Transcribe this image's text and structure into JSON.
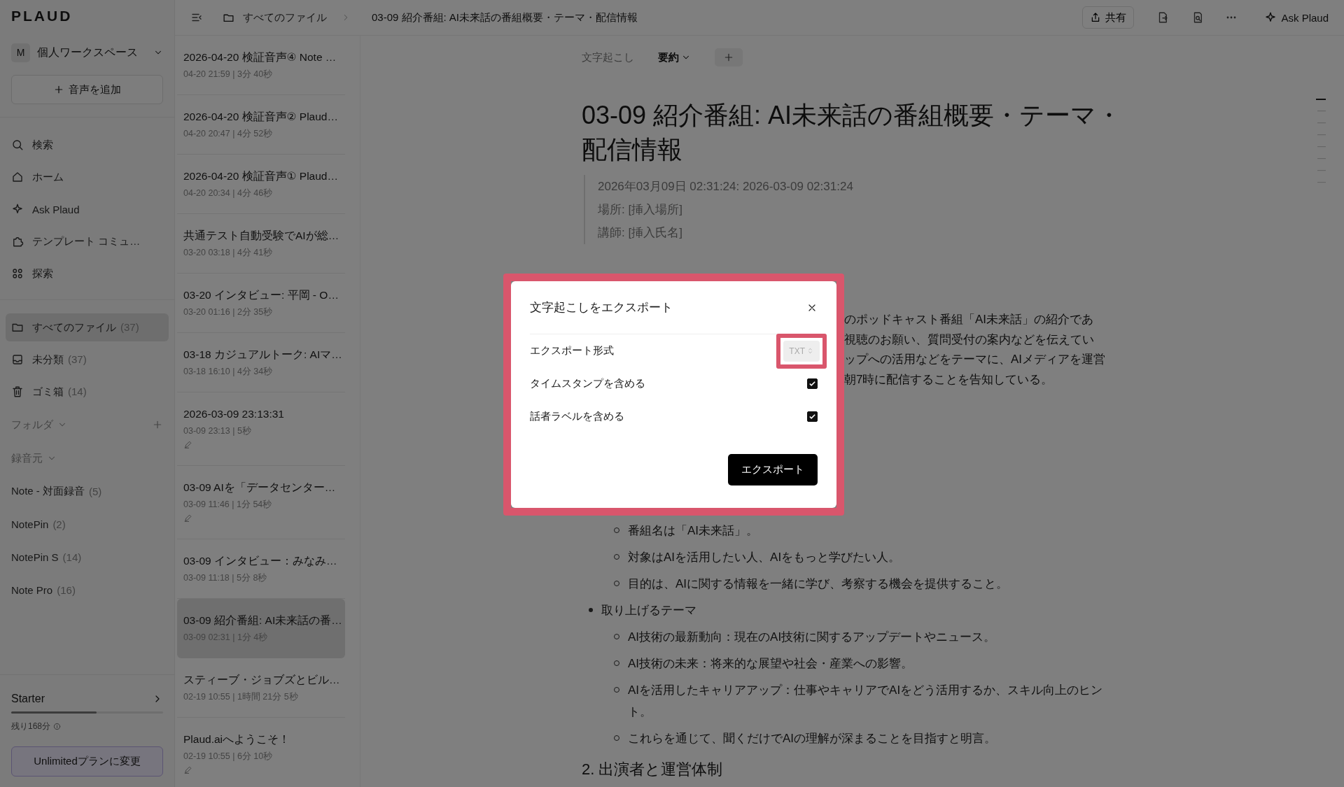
{
  "sidebar": {
    "logo": "PLAUD",
    "workspace": {
      "avatar": "M",
      "name": "個人ワークスペース"
    },
    "add_button": "音声を追加",
    "nav": [
      {
        "label": "検索"
      },
      {
        "label": "ホーム"
      },
      {
        "label": "Ask Plaud"
      },
      {
        "label": "テンプレート コミュ…"
      },
      {
        "label": "探索"
      }
    ],
    "library": [
      {
        "label": "すべてのファイル",
        "count": "(37)",
        "selected": true
      },
      {
        "label": "未分類",
        "count": "(37)",
        "selected": false
      },
      {
        "label": "ゴミ箱",
        "count": "(14)",
        "selected": false
      }
    ],
    "folders_label": "フォルダ",
    "sources_label": "録音元",
    "sources": [
      {
        "label": "Note - 対面録音",
        "count": "(5)"
      },
      {
        "label": "NotePin",
        "count": "(2)"
      },
      {
        "label": "NotePin S",
        "count": "(14)"
      },
      {
        "label": "Note Pro",
        "count": "(16)"
      }
    ],
    "plan": {
      "name": "Starter",
      "level": 0.56,
      "remaining": "残り168分",
      "upgrade_button": "Unlimitedプランに変更"
    }
  },
  "toolbar": {
    "breadcrumb": "すべてのファイル",
    "title": "03-09 紹介番組: AI未来話の番組概要・テーマ・配信情報",
    "share": "共有",
    "ask": "Ask Plaud"
  },
  "files": [
    {
      "title": "2026-04-20 検証音声④ Note …",
      "meta": "04-20 21:59 | 3分 40秒",
      "annotated": false,
      "selected": false
    },
    {
      "title": "2026-04-20 検証音声② Plaud…",
      "meta": "04-20 20:47 | 4分 52秒",
      "annotated": false,
      "selected": false
    },
    {
      "title": "2026-04-20 検証音声① Plaud…",
      "meta": "04-20 20:34 | 4分 46秒",
      "annotated": false,
      "selected": false
    },
    {
      "title": "共通テスト自動受験でAIが総…",
      "meta": "03-20 03:18 | 4分 41秒",
      "annotated": false,
      "selected": false
    },
    {
      "title": "03-20 インタビュー: 平岡 - O…",
      "meta": "03-20 01:16 | 2分 35秒",
      "annotated": false,
      "selected": false
    },
    {
      "title": "03-18 カジュアルトーク: AIマ…",
      "meta": "03-18 16:10 | 4分 34秒",
      "annotated": false,
      "selected": false
    },
    {
      "title": "2026-03-09 23:13:31",
      "meta": "03-09 23:13 | 5秒",
      "annotated": true,
      "selected": false
    },
    {
      "title": "03-09 AIを「データセンター…",
      "meta": "03-09 11:46 | 1分 54秒",
      "annotated": true,
      "selected": false
    },
    {
      "title": "03-09 インタビュー：みなみ…",
      "meta": "03-09 11:18 | 5分 8秒",
      "annotated": false,
      "selected": false
    },
    {
      "title": "03-09 紹介番組: AI未来話の番…",
      "meta": "03-09 02:31 | 1分 4秒",
      "annotated": false,
      "selected": true
    },
    {
      "title": "スティーブ・ジョブズとビル…",
      "meta": "02-19 10:55 | 1時間 21分 5秒",
      "annotated": false,
      "selected": false
    },
    {
      "title": "Plaud.aiへようこそ！",
      "meta": "02-19 10:55 | 6分 10秒",
      "annotated": true,
      "selected": false
    }
  ],
  "document": {
    "tabs": [
      {
        "label": "文字起こし",
        "selected": false
      },
      {
        "label": "要約",
        "selected": true
      }
    ],
    "title": "03-09 紹介番組: AI未来話の番組概要・テーマ・配信情報",
    "meta": [
      "2026年03月09日 02:31:24: 2026-03-09 02:31:24",
      "場所: [挿入場所]",
      "講師: [挿入氏名]"
    ],
    "overview_fragments": [
      "のポッドキャスト番組「AI未来話」の紹介であ",
      "視聴のお願い、質問受付の案内などを伝えてい",
      "ップへの活用などをテーマに、AIメディアを運営",
      "朝7時に配信することを告知している。"
    ],
    "items": [
      {
        "kind": "sub",
        "text": "番組名は「AI未来話」。"
      },
      {
        "kind": "sub",
        "text": "対象はAIを活用したい人、AIをもっと学びたい人。"
      },
      {
        "kind": "sub",
        "text": "目的は、AIに関する情報を一緒に学び、考察する機会を提供すること。"
      },
      {
        "kind": "main",
        "text": "取り上げるテーマ"
      },
      {
        "kind": "sub",
        "text": "AI技術の最新動向：現在のAI技術に関するアップデートやニュース。"
      },
      {
        "kind": "sub",
        "text": "AI技術の未来：将来的な展望や社会・産業への影響。"
      },
      {
        "kind": "sub",
        "text": "AIを活用したキャリアアップ：仕事やキャリアでAIをどう活用するか、スキル向上のヒント。"
      },
      {
        "kind": "sub",
        "text": "これらを通じて、聞くだけでAIの理解が深まることを目指すと明言。"
      }
    ],
    "section_heading": "2. 出演者と運営体制"
  },
  "dialog": {
    "title": "文字起こしをエクスポート",
    "format": {
      "label": "エクスポート形式",
      "value": "TXT",
      "disabled": true
    },
    "options": [
      {
        "label": "タイムスタンプを含める",
        "checked": true
      },
      {
        "label": "話者ラベルを含める",
        "checked": true
      }
    ],
    "export_button": "エクスポート"
  }
}
